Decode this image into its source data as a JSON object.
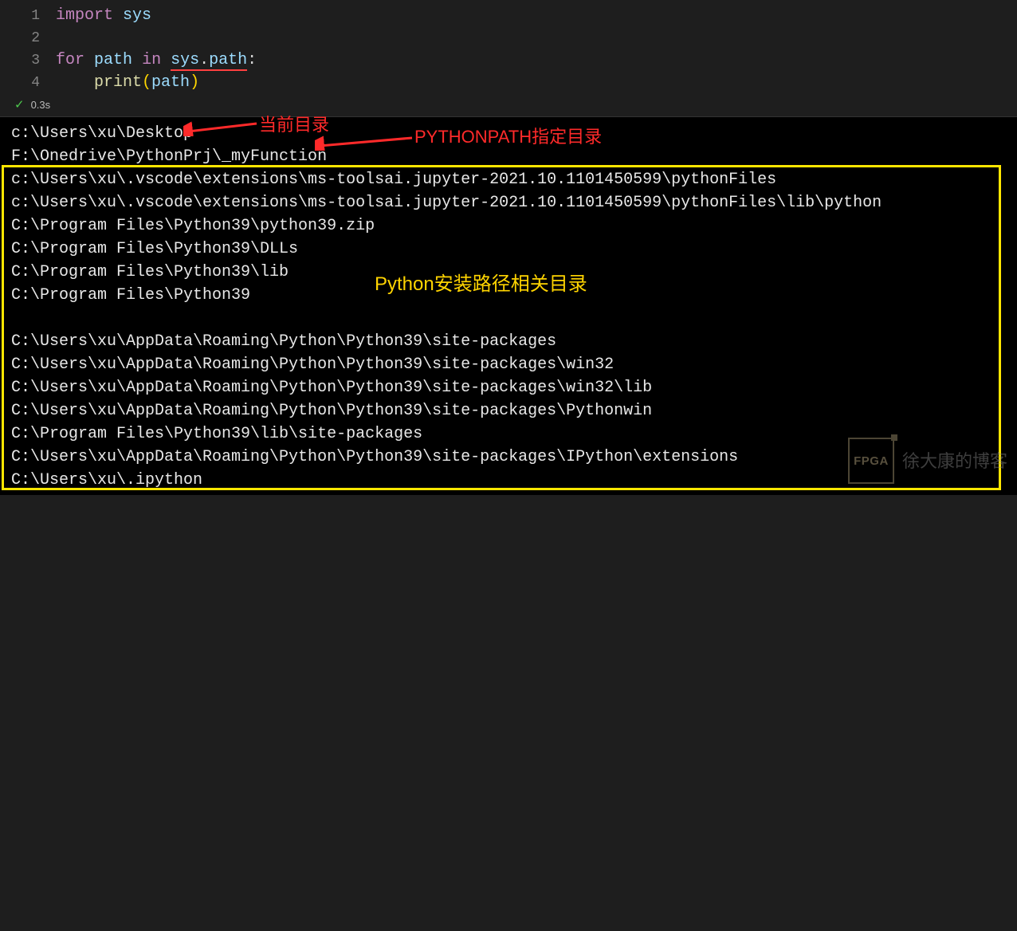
{
  "editor": {
    "lines": [
      {
        "num": "1",
        "tokens": [
          {
            "t": "import",
            "c": "kw-import"
          },
          {
            "t": " "
          },
          {
            "t": "sys",
            "c": "ident-sys"
          }
        ]
      },
      {
        "num": "2",
        "tokens": []
      },
      {
        "num": "3",
        "tokens": [
          {
            "t": "for",
            "c": "kw-for"
          },
          {
            "t": " "
          },
          {
            "t": "path",
            "c": "ident-path"
          },
          {
            "t": " "
          },
          {
            "t": "in",
            "c": "kw-in"
          },
          {
            "t": " "
          },
          {
            "t": "sys",
            "c": "ident-sys underline-red"
          },
          {
            "t": ".",
            "c": "dot underline-red"
          },
          {
            "t": "path",
            "c": "ident-path underline-red"
          },
          {
            "t": ":",
            "c": "dot"
          }
        ]
      },
      {
        "num": "4",
        "tokens": [
          {
            "t": "    "
          },
          {
            "t": "print",
            "c": "func"
          },
          {
            "t": "(",
            "c": "paren"
          },
          {
            "t": "path",
            "c": "ident-path"
          },
          {
            "t": ")",
            "c": "paren"
          }
        ]
      }
    ]
  },
  "status": {
    "check": "✓",
    "time": "0.3s"
  },
  "output": [
    "c:\\Users\\xu\\Desktop",
    "F:\\Onedrive\\PythonPrj\\_myFunction",
    "c:\\Users\\xu\\.vscode\\extensions\\ms-toolsai.jupyter-2021.10.1101450599\\pythonFiles",
    "c:\\Users\\xu\\.vscode\\extensions\\ms-toolsai.jupyter-2021.10.1101450599\\pythonFiles\\lib\\python",
    "C:\\Program Files\\Python39\\python39.zip",
    "C:\\Program Files\\Python39\\DLLs",
    "C:\\Program Files\\Python39\\lib",
    "C:\\Program Files\\Python39",
    "",
    "C:\\Users\\xu\\AppData\\Roaming\\Python\\Python39\\site-packages",
    "C:\\Users\\xu\\AppData\\Roaming\\Python\\Python39\\site-packages\\win32",
    "C:\\Users\\xu\\AppData\\Roaming\\Python\\Python39\\site-packages\\win32\\lib",
    "C:\\Users\\xu\\AppData\\Roaming\\Python\\Python39\\site-packages\\Pythonwin",
    "C:\\Program Files\\Python39\\lib\\site-packages",
    "C:\\Users\\xu\\AppData\\Roaming\\Python\\Python39\\site-packages\\IPython\\extensions",
    "C:\\Users\\xu\\.ipython"
  ],
  "annotations": {
    "a1": "当前目录",
    "a2": "PYTHONPATH指定目录",
    "a3": "Python安装路径相关目录"
  },
  "watermark": {
    "logo": "FPGA",
    "text": "徐大康的博客"
  }
}
